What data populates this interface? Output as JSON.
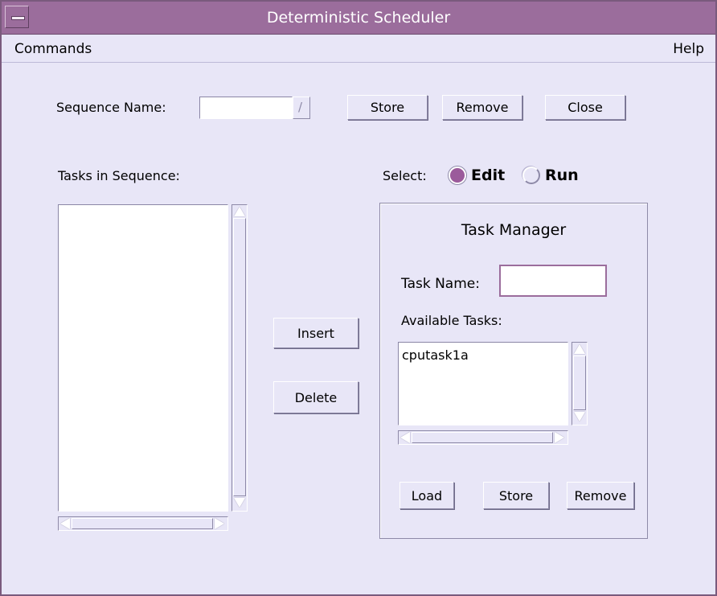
{
  "window": {
    "title": "Deterministic Scheduler"
  },
  "menubar": {
    "commands": "Commands",
    "help": "Help"
  },
  "sequence": {
    "label": "Sequence Name:",
    "value": "",
    "store": "Store",
    "remove": "Remove",
    "close": "Close"
  },
  "tasks_in_sequence": {
    "label": "Tasks in Sequence:",
    "items": []
  },
  "actions": {
    "insert": "Insert",
    "delete": "Delete"
  },
  "select": {
    "label": "Select:",
    "edit": "Edit",
    "run": "Run",
    "selected": "Edit"
  },
  "task_manager": {
    "title": "Task Manager",
    "task_name_label": "Task Name:",
    "task_name_value": "",
    "available_label": "Available Tasks:",
    "available_items": [
      "cputask1a"
    ],
    "load": "Load",
    "store": "Store",
    "remove": "Remove"
  },
  "colors": {
    "titlebar": "#9b6d9c",
    "background": "#e8e6f7",
    "radio_selected": "#9b5b9b"
  }
}
